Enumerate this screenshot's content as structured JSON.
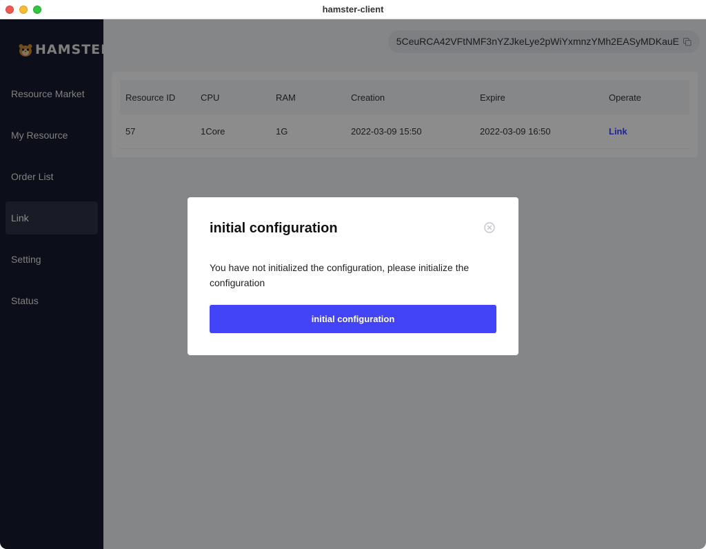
{
  "window": {
    "title": "hamster-client"
  },
  "sidebar": {
    "logo_text": "HAMSTER",
    "logo_icon": "hamster-icon",
    "items": [
      {
        "label": "Resource Market",
        "active": false
      },
      {
        "label": "My Resource",
        "active": false
      },
      {
        "label": "Order List",
        "active": false
      },
      {
        "label": "Link",
        "active": true
      },
      {
        "label": "Setting",
        "active": false
      },
      {
        "label": "Status",
        "active": false
      }
    ]
  },
  "topbar": {
    "address": "5CeuRCA42VFtNMF3nYZJkeLye2pWiYxmnzYMh2EASyMDKauE",
    "copy_icon": "copy-icon"
  },
  "table": {
    "headers": [
      "Resource ID",
      "CPU",
      "RAM",
      "Creation",
      "Expire",
      "Operate"
    ],
    "rows": [
      {
        "resource_id": "57",
        "cpu": "1Core",
        "ram": "1G",
        "creation": "2022-03-09 15:50",
        "expire": "2022-03-09 16:50",
        "operate": "Link"
      }
    ]
  },
  "modal": {
    "title": "initial configuration",
    "message": "You have not initialized the configuration, please initialize the configuration",
    "button_label": "initial configuration",
    "close_icon": "close-circle-icon"
  },
  "colors": {
    "sidebar_bg": "#161b2f",
    "accent": "#4343f8",
    "link": "#3b44f6"
  }
}
